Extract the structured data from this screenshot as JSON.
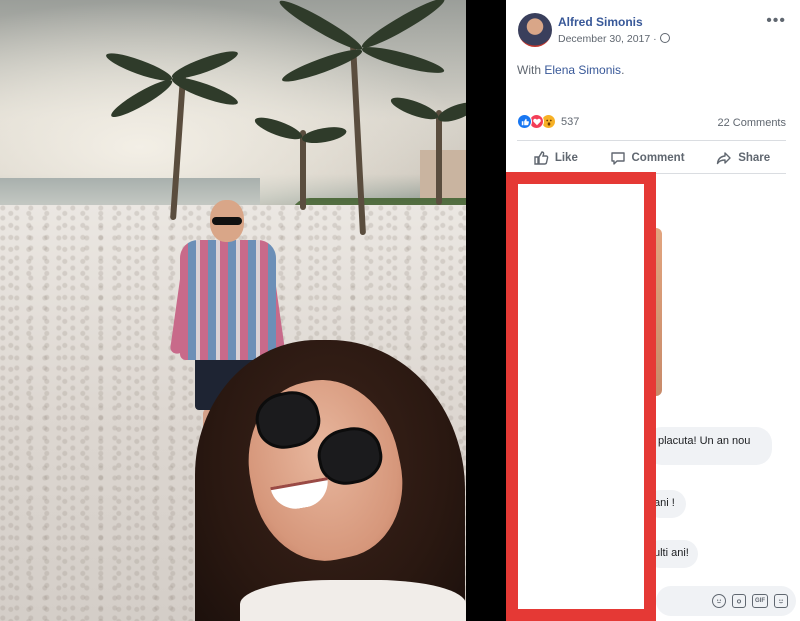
{
  "post": {
    "author": "Alfred Simonis",
    "date": "December 30, 2017",
    "with_prefix": "With ",
    "tagged_name": "Elena Simonis",
    "with_suffix": ".",
    "reaction_count": "537",
    "comments_count": "22 Comments"
  },
  "actions": {
    "like": "Like",
    "comment": "Comment",
    "share": "Share"
  },
  "comments": [
    {
      "text": "placuta! Un an nou"
    },
    {
      "text": "ani !"
    },
    {
      "text": "ulti ani!"
    }
  ],
  "composer": {
    "icons": [
      "emoji-icon",
      "camera-icon",
      "gif-icon",
      "sticker-icon"
    ],
    "gif_label": "GIF"
  },
  "colors": {
    "brand_link": "#385898",
    "redaction": "#e53935",
    "like_blue": "#1877f2",
    "love_red": "#f33e58",
    "wow_yellow": "#f7b125"
  }
}
